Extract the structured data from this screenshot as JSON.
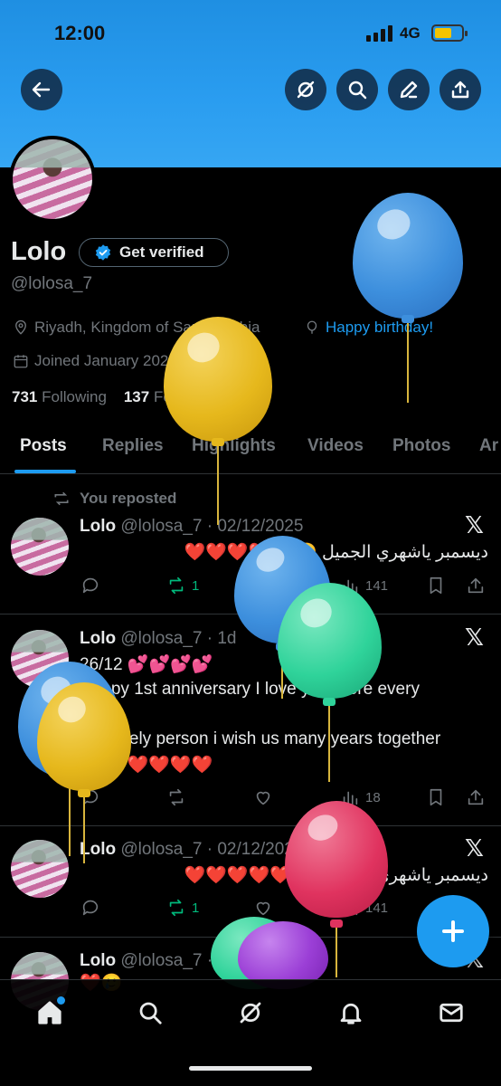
{
  "status_bar": {
    "time": "12:00",
    "network": "4G"
  },
  "profile": {
    "name": "Lolo",
    "verify_label": "Get verified",
    "handle": "@lolosa_7",
    "location": "Riyadh, Kingdom of Saudi Arabia",
    "birthday_link": "Happy birthday!",
    "joined": "Joined January 2022",
    "following_count": "731",
    "following_label": "Following",
    "followers_count": "137",
    "followers_label": "Followers"
  },
  "tabs": [
    "Posts",
    "Replies",
    "Highlights",
    "Videos",
    "Photos",
    "Ar"
  ],
  "feed": {
    "repost_label": "You reposted",
    "posts": [
      {
        "name": "Lolo",
        "meta": "@lolosa_7 · 02/12/2025",
        "text": "ديسمبر ياشهري الجميل 🥲 ❤️❤️❤️❤️❤️",
        "reposts": "1",
        "views": "141"
      },
      {
        "name": "Lolo",
        "meta": "@lolosa_7 · 1d",
        "line1": "26/12 💕💕💕💕",
        "line2": "Happy 1st anniversary I love you more every",
        "line3": "year",
        "line4": "My lovely person i wish us many years together",
        "line5": "🥲 ❤️❤️❤️❤️❤️",
        "views": "18"
      },
      {
        "name": "Lolo",
        "meta": "@lolosa_7 · 02/12/2025",
        "text": "ديسمبر ياشهري الجميل 🥲 ❤️❤️❤️❤️❤️",
        "reposts": "1",
        "views": "141"
      },
      {
        "name": "Lolo",
        "meta": "@lolosa_7 · 01/12/2025",
        "text": "❤️🥲"
      }
    ]
  },
  "colors": {
    "accent": "#1d9bf0",
    "repost_green": "#00ba7c",
    "balloon_blue": "#3d8fdd",
    "balloon_yellow": "#e6b81c",
    "balloon_green": "#2fd39a",
    "balloon_red": "#e0335f",
    "balloon_purple": "#9b3fd6"
  },
  "nav": [
    "home-icon",
    "search-icon",
    "grok-icon",
    "notifications-icon",
    "messages-icon"
  ]
}
